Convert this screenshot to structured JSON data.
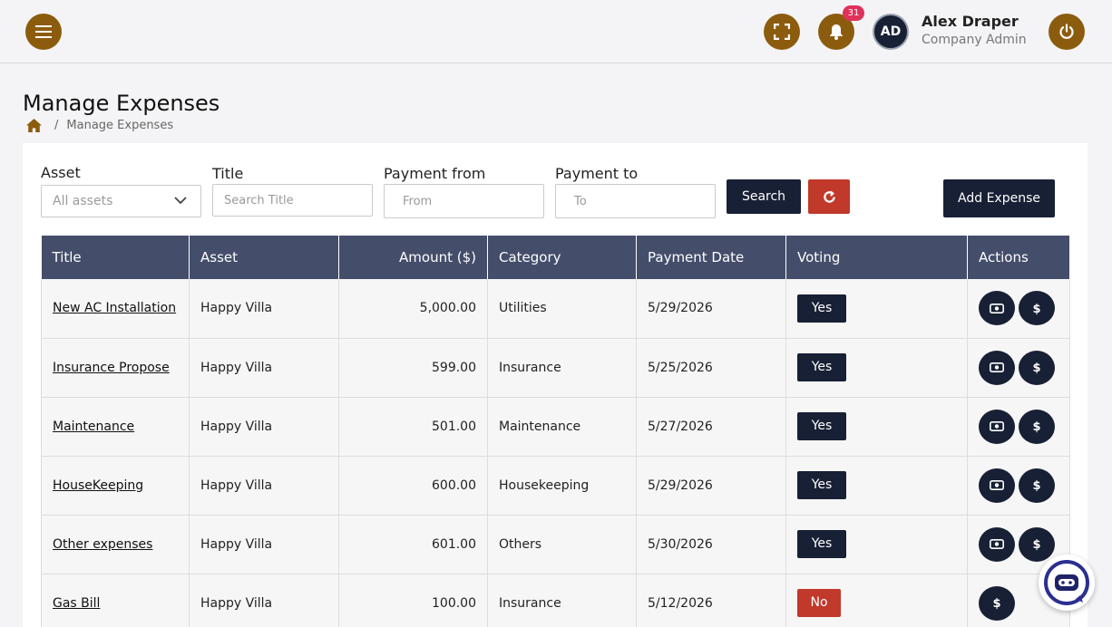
{
  "header": {
    "user_initials": "AD",
    "user_name": "Alex Draper",
    "user_role": "Company Admin",
    "notification_count": "31"
  },
  "page": {
    "title": "Manage Expenses",
    "breadcrumb_current": "Manage Expenses",
    "breadcrumb_sep": "/"
  },
  "filters": {
    "asset_label": "Asset",
    "asset_value": "All assets",
    "title_label": "Title",
    "title_placeholder": "Search Title",
    "from_label": "Payment from",
    "from_placeholder": "From",
    "to_label": "Payment to",
    "to_placeholder": "To",
    "search_label": "Search",
    "add_label": "Add Expense"
  },
  "table": {
    "columns": [
      "Title",
      "Asset",
      "Amount ($)",
      "Category",
      "Payment Date",
      "Voting",
      "Actions"
    ],
    "rows": [
      {
        "title": "New AC Installation",
        "asset": "Happy Villa",
        "amount": "5,000.00",
        "category": "Utilities",
        "date": "5/29/2026",
        "voting": "Yes"
      },
      {
        "title": "Insurance Propose",
        "asset": "Happy Villa",
        "amount": "599.00",
        "category": "Insurance",
        "date": "5/25/2026",
        "voting": "Yes"
      },
      {
        "title": "Maintenance",
        "asset": "Happy Villa",
        "amount": "501.00",
        "category": "Maintenance",
        "date": "5/27/2026",
        "voting": "Yes"
      },
      {
        "title": "HouseKeeping",
        "asset": "Happy Villa",
        "amount": "600.00",
        "category": "Housekeeping",
        "date": "5/29/2026",
        "voting": "Yes"
      },
      {
        "title": "Other expenses",
        "asset": "Happy Villa",
        "amount": "601.00",
        "category": "Others",
        "date": "5/30/2026",
        "voting": "Yes"
      },
      {
        "title": "Gas Bill",
        "asset": "Happy Villa",
        "amount": "100.00",
        "category": "Insurance",
        "date": "5/12/2026",
        "voting": "No"
      }
    ]
  },
  "colors": {
    "brand_gold": "#8c5c0e",
    "navy": "#182035",
    "header_slate": "#444e6b",
    "danger": "#c0392b",
    "badge": "#e0315a"
  },
  "icons": [
    "menu-icon",
    "fullscreen-icon",
    "bell-icon",
    "power-icon",
    "home-icon",
    "chevron-down-icon",
    "refresh-icon",
    "money-icon",
    "dollar-icon",
    "chatbot-icon"
  ]
}
